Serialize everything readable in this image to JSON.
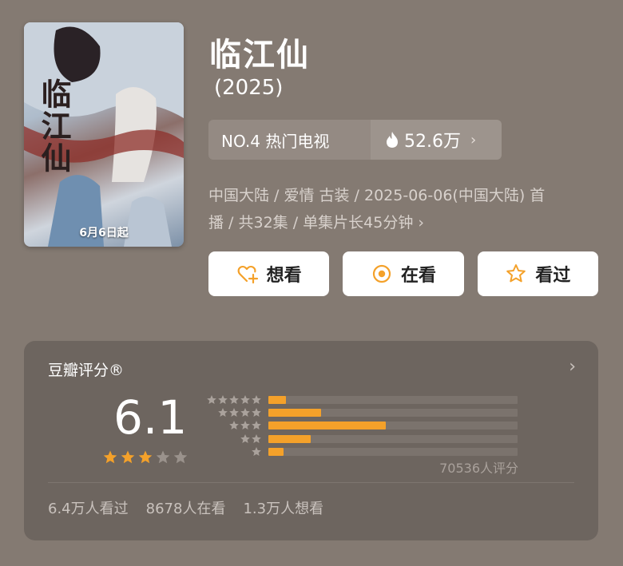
{
  "poster": {
    "title": "临江仙",
    "date": "6月6日起"
  },
  "show": {
    "title": "临江仙",
    "year": "(2025)",
    "rank_label": "NO.4 热门电视",
    "heat_value": "52.6万",
    "meta_line1": "中国大陆 / 爱情 古装 / 2025-06-06(中国大陆) 首",
    "meta_line2": "播 / 共32集 / 单集片长45分钟"
  },
  "actions": [
    {
      "label": "想看",
      "icon": "heart-plus-icon"
    },
    {
      "label": "在看",
      "icon": "target-icon"
    },
    {
      "label": "看过",
      "icon": "star-outline-icon"
    }
  ],
  "rating": {
    "title": "豆瓣评分®",
    "score": "6.1",
    "stars_filled": 3,
    "stars_total": 5,
    "distribution": [
      {
        "stars": 5,
        "percent": 7
      },
      {
        "stars": 4,
        "percent": 21
      },
      {
        "stars": 3,
        "percent": 47
      },
      {
        "stars": 2,
        "percent": 17
      },
      {
        "stars": 1,
        "percent": 6
      }
    ],
    "count_text": "70536人评分",
    "summary": [
      "6.4万人看过",
      "8678人在看",
      "1.3万人想看"
    ]
  },
  "colors": {
    "accent": "#f4a12a",
    "background": "#847a72",
    "card": "#6d655f"
  }
}
